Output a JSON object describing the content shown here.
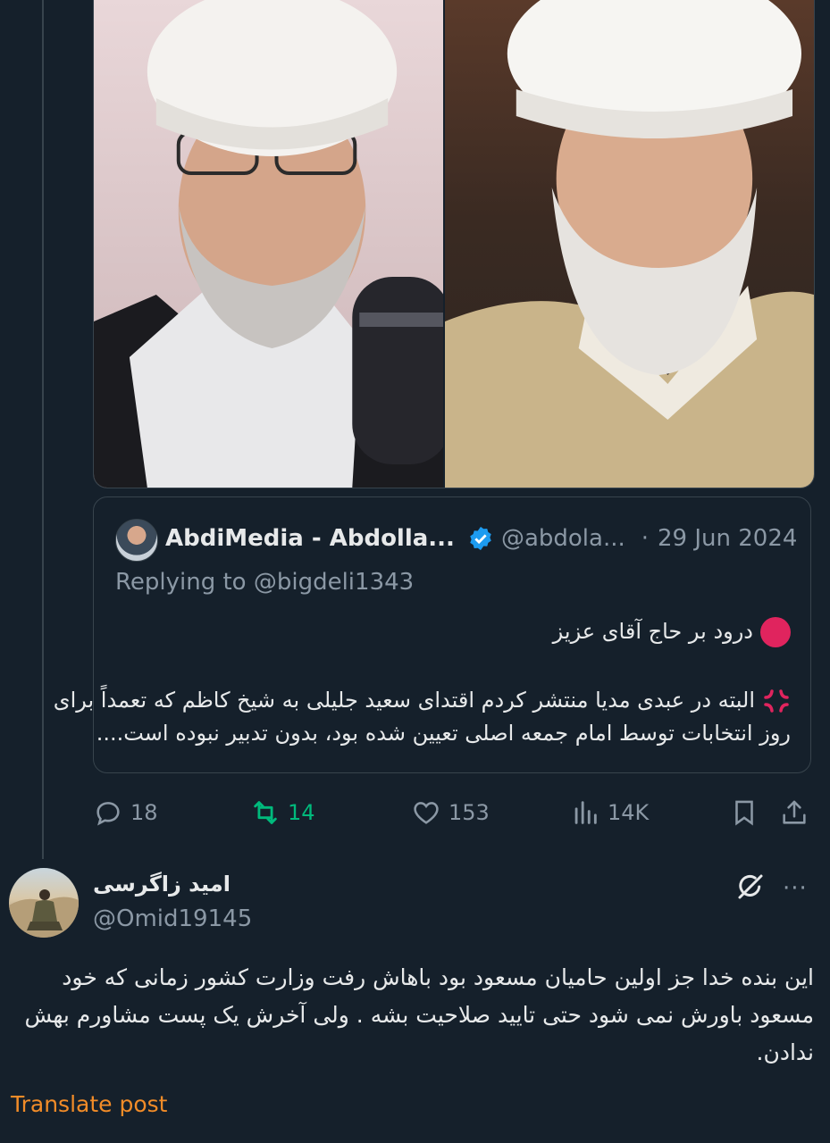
{
  "quoted_tweet": {
    "author_name": "AbdiMedia - Abdolla...",
    "handle": "@abdola...",
    "separator": "·",
    "date": "29 Jun 2024",
    "replying_to": "Replying to @bigdeli1343",
    "line1": "درود بر حاج آقای عزیز",
    "line2": "البته در عبدی مدیا منتشر کردم اقتدای سعید جلیلی به شیخ کاظم که تعمداً برای",
    "line3": "روز انتخابات توسط امام جمعه اصلی تعیین شده بود، بدون تدبیر نبوده است...."
  },
  "actions": {
    "replies": "18",
    "retweets": "14",
    "likes": "153",
    "views": "14K"
  },
  "reply_tweet": {
    "author_name": "امید زاگرسی",
    "handle": "@Omid19145",
    "more": "···",
    "body_line1": "این بنده خدا جز اولین حامیان مسعود بود باهاش رفت وزارت کشور زمانی که خود",
    "body_line2": "مسعود باورش نمی شود حتی تایید صلاحیت بشه . ولی آخرش یک پست مشاورم بهش",
    "body_line3": "ندادن.",
    "translate": "Translate post"
  },
  "colors": {
    "background": "#15202b",
    "retweet_green": "#00ba7c",
    "verified_blue": "#1d9bf0",
    "translate_orange": "#f28c28"
  }
}
